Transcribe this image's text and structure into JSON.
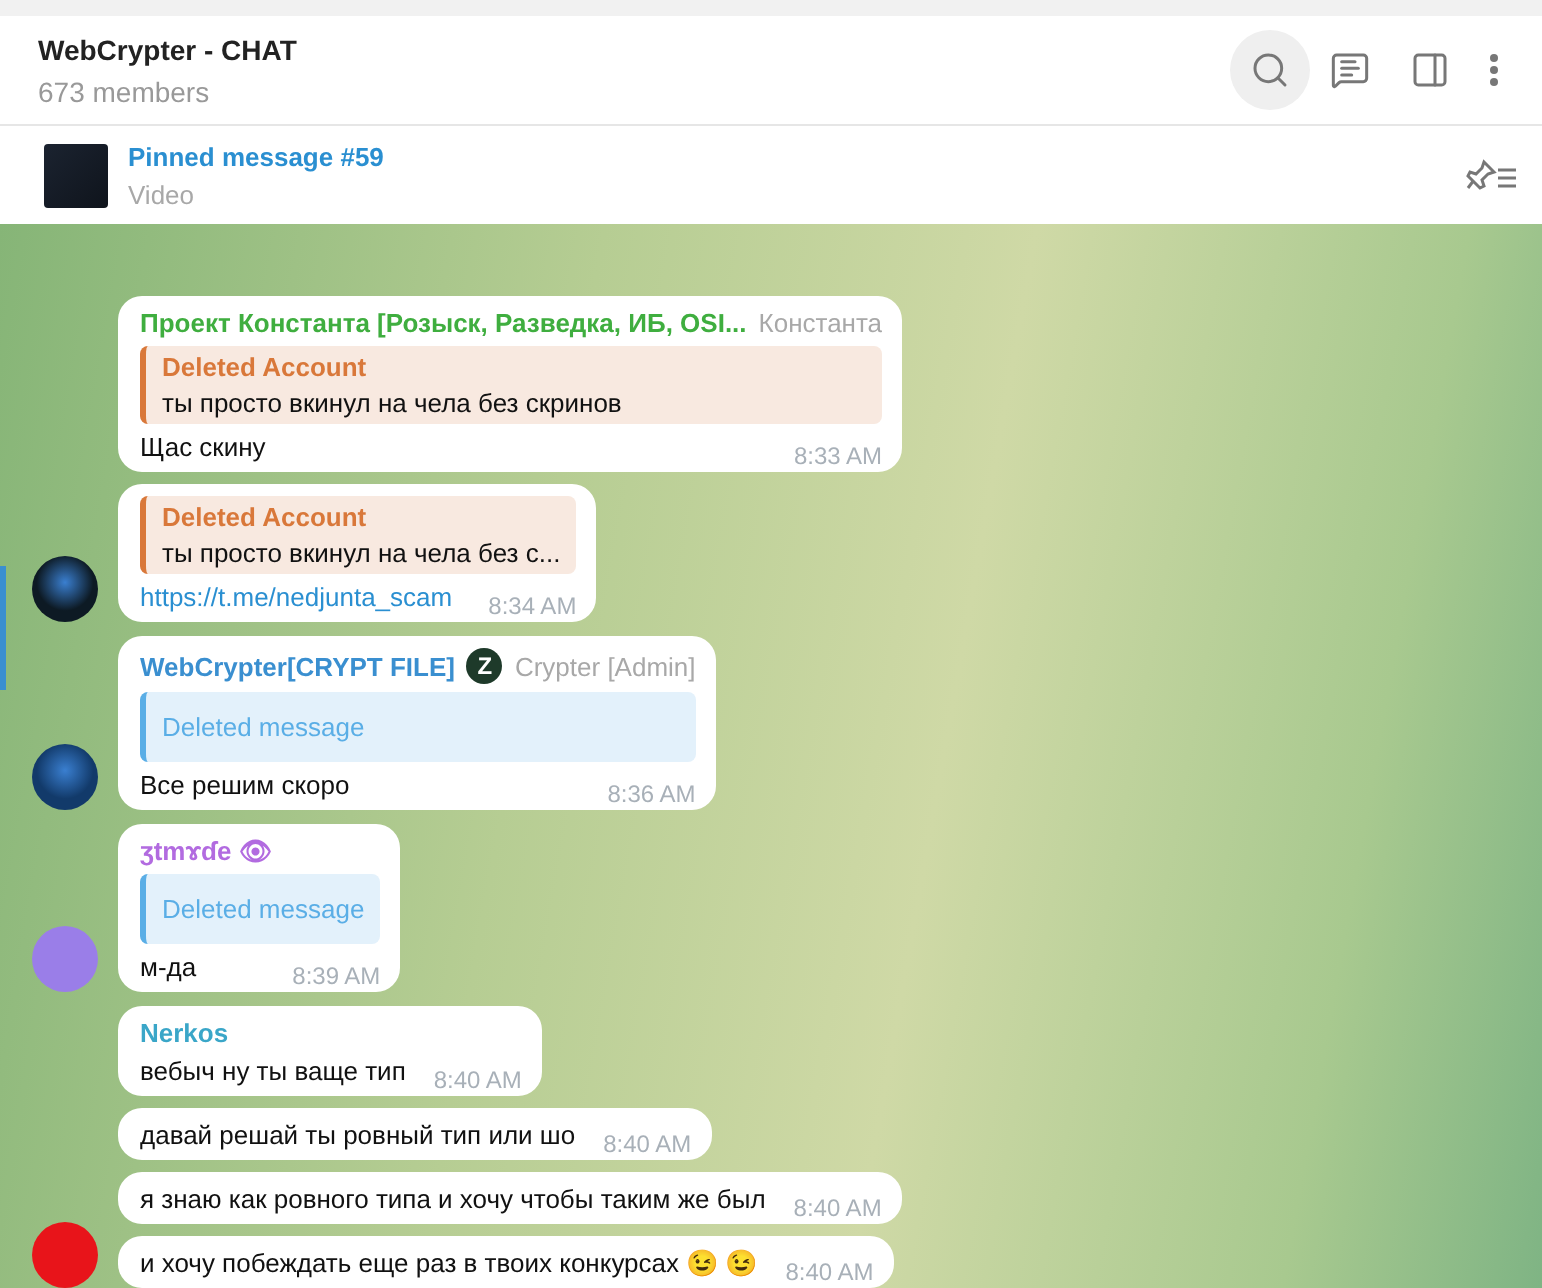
{
  "header": {
    "title": "WebCrypter - CHAT",
    "subtitle": "673 members"
  },
  "pinned": {
    "title": "Pinned message #59",
    "subtitle": "Video"
  },
  "groups": [
    {
      "avatar": {
        "kind": "photo",
        "color": "#0d1a24"
      },
      "bubbles": [
        {
          "sender": {
            "name": "Проект Константа [Розыск, Разведка, ИБ, OSI...",
            "color": "#3fae3f",
            "rank": "Константа"
          },
          "reply": {
            "kind": "account",
            "author": "Deleted Account",
            "text": "ты просто вкинул на чела без скринов"
          },
          "text": "Щас скину",
          "time": "8:33 AM"
        },
        {
          "reply": {
            "kind": "account",
            "author": "Deleted Account",
            "text": "ты просто вкинул на чела без с..."
          },
          "link": "https://t.me/nedjunta_scam",
          "time": "8:34 AM"
        }
      ]
    },
    {
      "avatar": {
        "kind": "photo",
        "color": "#123a6a"
      },
      "bubbles": [
        {
          "sender": {
            "name": "WebCrypter[CRYPT FILE]",
            "color": "#3a8fd0",
            "badge": "Z",
            "rank": "Crypter [Admin]"
          },
          "reply": {
            "kind": "deleted",
            "text": "Deleted message"
          },
          "text": "Все решим скоро",
          "time": "8:36 AM"
        }
      ]
    },
    {
      "avatar": {
        "kind": "plain",
        "color": "#9a7ee8"
      },
      "bubbles": [
        {
          "sender": {
            "name": "ʒtmɤɗe 👁",
            "color": "#b26be0"
          },
          "reply": {
            "kind": "deleted",
            "text": "Deleted message"
          },
          "text": "м-да",
          "time": "8:39 AM"
        }
      ]
    },
    {
      "avatar": {
        "kind": "plain",
        "color": "#e8141a"
      },
      "bubbles": [
        {
          "sender": {
            "name": "Nerkos",
            "color": "#3aa6c8"
          },
          "text": "вебыч ну ты ваще тип",
          "time": "8:40 AM"
        },
        {
          "text": "давай решай ты ровный тип или шо",
          "time": "8:40 AM"
        },
        {
          "text": "я знаю как ровного типа и хочу чтобы таким же был",
          "time": "8:40 AM"
        },
        {
          "text": "и хочу побеждать еще раз в твоих конкурсах 😉 😉",
          "time": "8:40 AM"
        }
      ]
    }
  ]
}
